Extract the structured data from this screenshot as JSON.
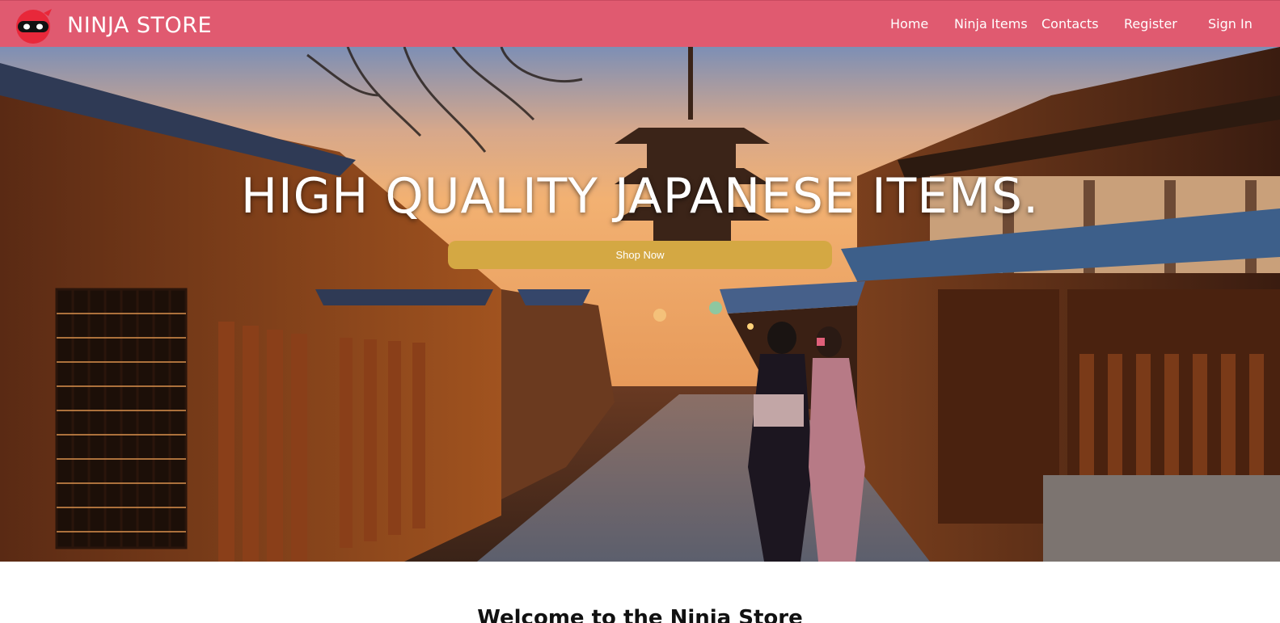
{
  "brand": {
    "name": "NINJA STORE",
    "logo_icon": "ninja-mask-icon"
  },
  "nav": {
    "items": [
      {
        "label": "Home"
      },
      {
        "label": "Ninja Items"
      },
      {
        "label": "Contacts"
      },
      {
        "label": "Register"
      },
      {
        "label": "Sign In"
      }
    ]
  },
  "hero": {
    "title": "HIGH QUALITY JAPANESE ITEMS.",
    "cta_label": "Shop Now"
  },
  "section": {
    "heading": "Welcome to the Ninja Store"
  },
  "colors": {
    "navbar": "#e05a70",
    "cta": "#d4a843",
    "text_light": "#ffffff"
  }
}
